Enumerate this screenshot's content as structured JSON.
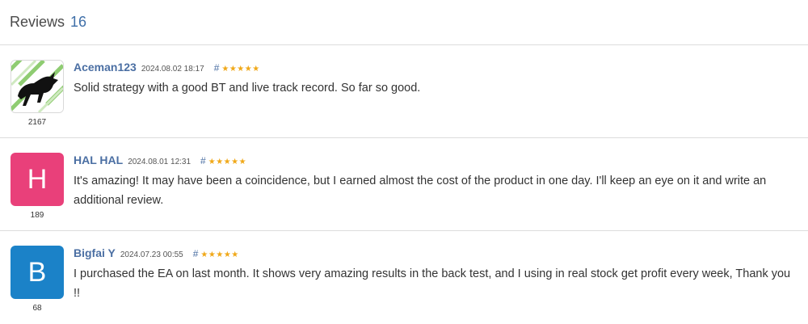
{
  "header": {
    "title": "Reviews",
    "count": "16"
  },
  "reviews": [
    {
      "author": "Aceman123",
      "date": "2024.08.02 18:17",
      "hash": "#",
      "stars": "★★★★★",
      "rating": "2167",
      "avatar_type": "image",
      "text": "Solid strategy with a good BT and live track record. So far so good."
    },
    {
      "author": "HAL HAL",
      "date": "2024.08.01 12:31",
      "hash": "#",
      "stars": "★★★★★",
      "rating": "189",
      "avatar_type": "letter",
      "avatar_letter": "H",
      "avatar_color": "#e9407a",
      "text": "It's amazing! It may have been a coincidence, but I earned almost the cost of the product in one day. I'll keep an eye on it and write an additional review."
    },
    {
      "author": "Bigfai Y",
      "date": "2024.07.23 00:55",
      "hash": "#",
      "stars": "★★★★★",
      "rating": "68",
      "avatar_type": "letter",
      "avatar_letter": "B",
      "avatar_color": "#1b82c8",
      "text": "I purchased the EA on last month. It shows very amazing results in the back test, and I using in real stock get profit every week, Thank you !!"
    }
  ]
}
